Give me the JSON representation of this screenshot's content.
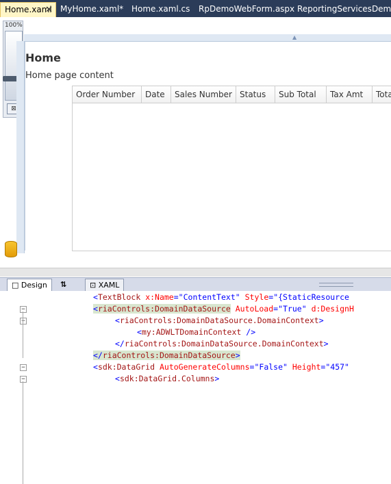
{
  "tabs": [
    {
      "label": "Home.xaml",
      "active": true
    },
    {
      "label": "MyHome.xaml*",
      "active": false
    },
    {
      "label": "Home.xaml.cs",
      "active": false
    },
    {
      "label": "RpDemoWebForm.aspx",
      "active": false
    },
    {
      "label": "ReportingServicesDemoTestPage",
      "active": false
    }
  ],
  "tab_close_glyph": "✕",
  "zoom": {
    "label": "100%",
    "fit_glyph": "⊠"
  },
  "page": {
    "title": "Home",
    "content": "Home page content"
  },
  "grid": {
    "columns": [
      "Order Number",
      "Date",
      "Sales Number",
      "Status",
      "Sub Total",
      "Tax Amt",
      "Total"
    ]
  },
  "view_tabs": {
    "design": "Design",
    "swap": "⇅",
    "xaml": "XAML"
  },
  "code": [
    {
      "tag": "TextBlock",
      "attrs": [
        [
          "x:Name",
          "\"ContentText\""
        ],
        [
          "Style",
          "\"{StaticResource"
        ]
      ],
      "prefix": "<",
      "suffix": "",
      "highlight": false
    },
    {
      "tag": "riaControls:DomainDataSource",
      "attrs": [
        [
          "AutoLoad",
          "\"True\""
        ],
        [
          "d:DesignH",
          ""
        ]
      ],
      "prefix": "<",
      "suffix": "",
      "highlight": true
    },
    {
      "tag": "riaControls:DomainDataSource.DomainContext",
      "attrs": [],
      "prefix": "<",
      "suffix": ">",
      "highlight": false
    },
    {
      "tag": "my:ADWLTDomainContext",
      "attrs": [],
      "prefix": "<",
      "suffix": " />",
      "highlight": false
    },
    {
      "tag": "riaControls:DomainDataSource.DomainContext",
      "attrs": [],
      "prefix": "</",
      "suffix": ">",
      "highlight": false
    },
    {
      "tag": "riaControls:DomainDataSource",
      "attrs": [],
      "prefix": "</",
      "suffix": ">",
      "highlight": true
    },
    {
      "tag": "sdk:DataGrid",
      "attrs": [
        [
          "AutoGenerateColumns",
          "\"False\""
        ],
        [
          "Height",
          "\"457\""
        ]
      ],
      "prefix": "<",
      "suffix": "",
      "highlight": false
    },
    {
      "tag": "sdk:DataGrid.Columns",
      "attrs": [],
      "prefix": "<",
      "suffix": ">",
      "highlight": false
    }
  ],
  "colors": {
    "tab_bar": "#2b3c59",
    "active_tab": "#fff6c7",
    "tag": "#a31515",
    "attr": "#ff0000",
    "value": "#0000ff"
  }
}
